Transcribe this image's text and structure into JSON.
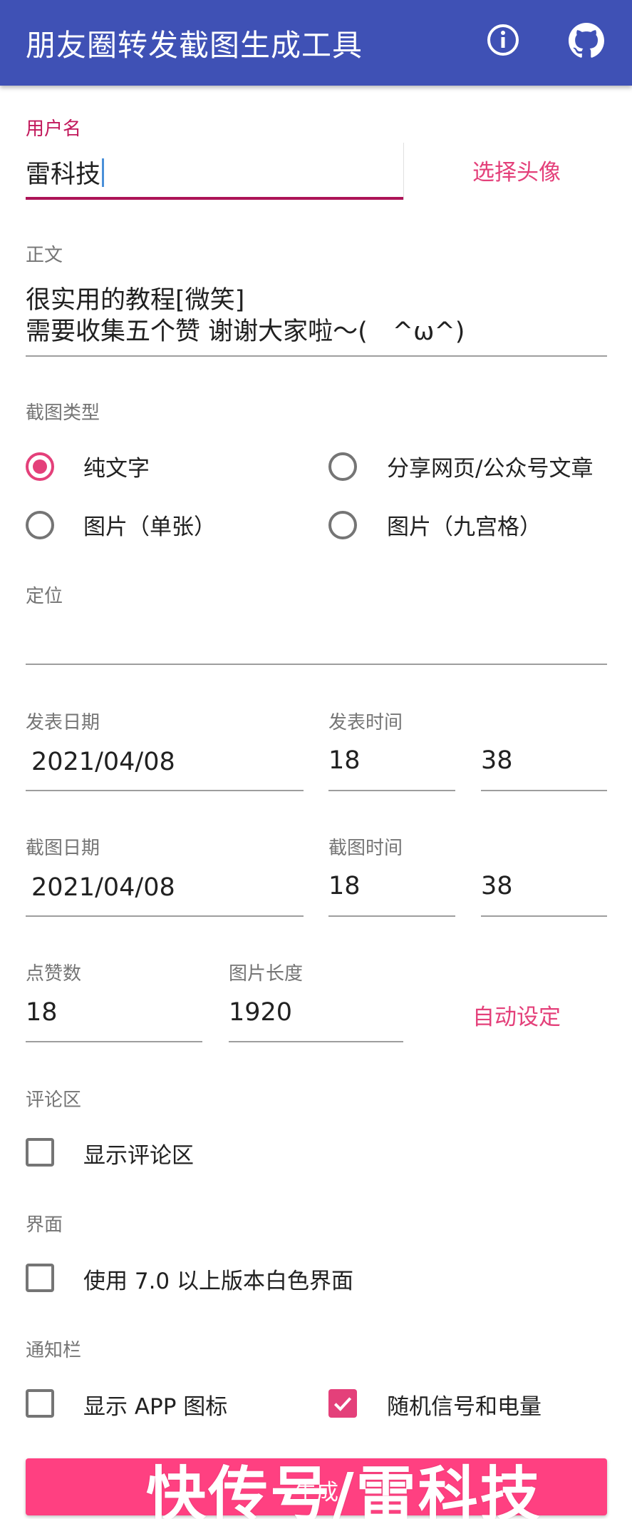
{
  "app": {
    "title": "朋友圈转发截图生成工具"
  },
  "icons": {
    "info": "info-icon",
    "github": "github-icon"
  },
  "colors": {
    "primary": "#3f51b5",
    "accent": "#ff4081",
    "active_underline": "#ad1457"
  },
  "username": {
    "label": "用户名",
    "value": "雷科技",
    "avatar_button": "选择头像"
  },
  "body": {
    "label": "正文",
    "line1": "很实用的教程[微笑]",
    "line2": "需要收集五个赞 谢谢大家啦～(　^ω^)"
  },
  "screenshot_type": {
    "label": "截图类型",
    "options": [
      {
        "label": "纯文字",
        "checked": true
      },
      {
        "label": "分享网页/公众号文章",
        "checked": false
      },
      {
        "label": "图片（单张）",
        "checked": false
      },
      {
        "label": "图片（九宫格）",
        "checked": false
      }
    ]
  },
  "location": {
    "label": "定位",
    "value": ""
  },
  "publish": {
    "date_label": "发表日期",
    "date": "2021/04/08",
    "time_label": "发表时间",
    "hour": "18",
    "minute": "38"
  },
  "capture": {
    "date_label": "截图日期",
    "date": "2021/04/08",
    "time_label": "截图时间",
    "hour": "18",
    "minute": "38"
  },
  "likes": {
    "label": "点赞数",
    "value": "18"
  },
  "image_length": {
    "label": "图片长度",
    "value": "1920",
    "auto_button": "自动设定"
  },
  "comments": {
    "section": "评论区",
    "show_label": "显示评论区",
    "checked": false
  },
  "ui": {
    "section": "界面",
    "white_label": "使用 7.0 以上版本白色界面",
    "checked": false
  },
  "statusbar": {
    "section": "通知栏",
    "app_icon_label": "显示 APP 图标",
    "app_icon_checked": false,
    "random_label": "随机信号和电量",
    "random_checked": true
  },
  "generate": {
    "label": "生成"
  },
  "watermark": "快传号/雷科技"
}
